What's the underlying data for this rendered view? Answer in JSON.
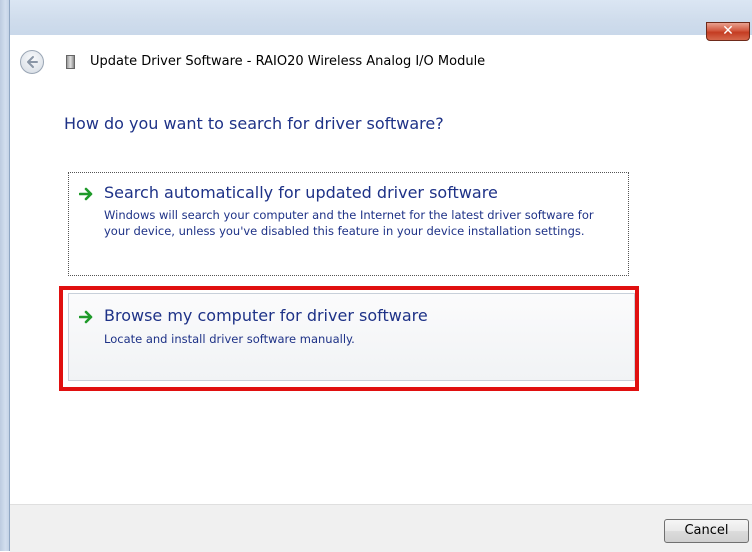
{
  "window": {
    "title": "Update Driver Software - RAIO20 Wireless Analog I/O Module",
    "close_label": "✕"
  },
  "heading": "How do you want to search for driver software?",
  "options": [
    {
      "title": "Search automatically for updated driver software",
      "description": "Windows will search your computer and the Internet for the latest driver software for your device, unless you've disabled this feature in your device installation settings.",
      "icon": "green-arrow-icon"
    },
    {
      "title": "Browse my computer for driver software",
      "description": "Locate and install driver software manually.",
      "icon": "green-arrow-icon"
    }
  ],
  "footer": {
    "cancel_label": "Cancel"
  },
  "colors": {
    "link_blue": "#1e3287",
    "highlight_red": "#e01010",
    "arrow_green": "#1f9a2a"
  }
}
